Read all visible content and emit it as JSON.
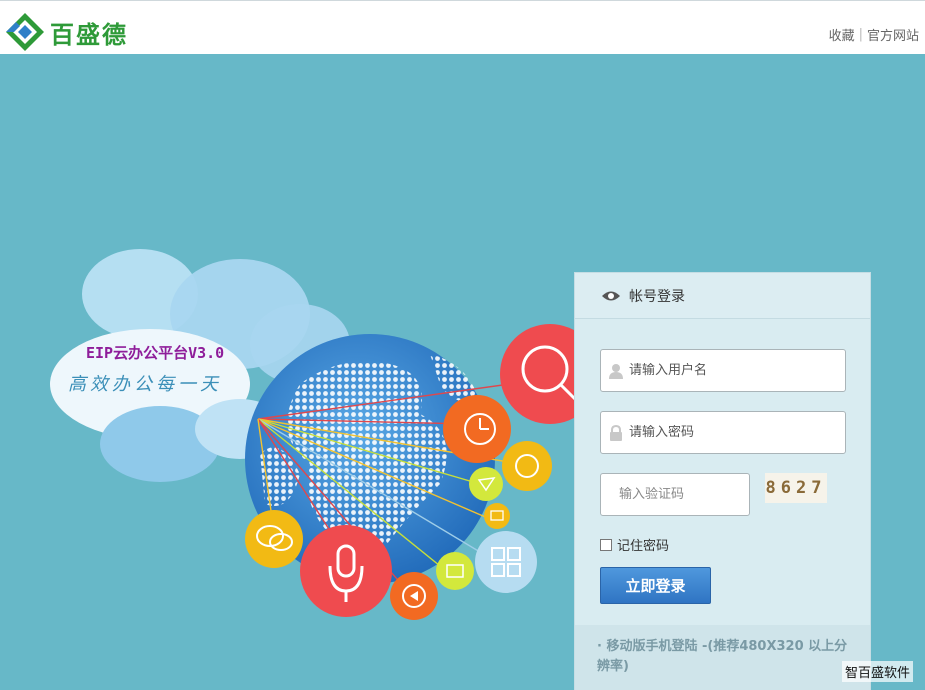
{
  "brand": {
    "name": "百盛德",
    "logo_icon": "diamond-logo-icon",
    "colors": {
      "green": "#2e9a38",
      "blue": "#2f80c8"
    }
  },
  "top_links": {
    "favorite": "收藏",
    "official_site": "官方网站"
  },
  "hero": {
    "product": "EIP云办公平台V3.0",
    "tagline": "高效办公每一天"
  },
  "login": {
    "title": "帐号登录",
    "title_icon": "eye-icon",
    "username_placeholder": "请输入用户名",
    "password_placeholder": "请输入密码",
    "captcha_placeholder": "输入验证码",
    "captcha_code": "8627",
    "remember_label": "记住密码",
    "submit_label": "立即登录",
    "mobile_note": "· 移动版手机登陆 -(推荐480X320 以上分辨率)"
  },
  "watermark": "智百盛软件",
  "colors": {
    "background": "#67b8c8",
    "panel": "#d9ecf1",
    "button": "#3a82cf"
  }
}
